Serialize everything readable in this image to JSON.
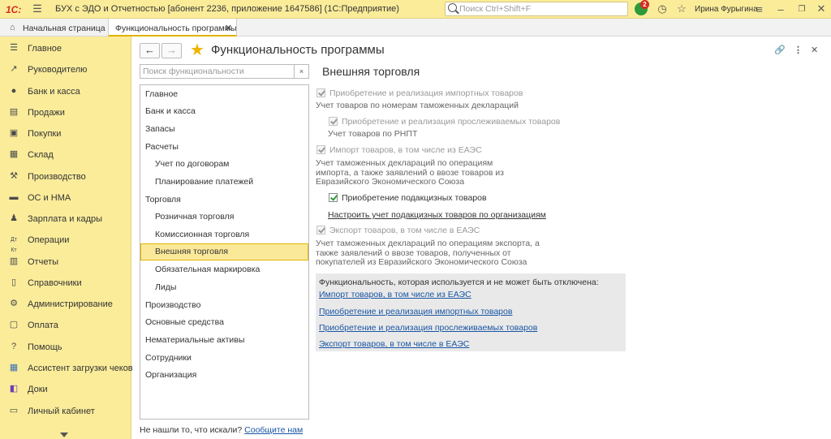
{
  "topbar": {
    "logo": "1С:",
    "title": "БУХ с ЭДО и Отчетностью [абонент 2236, приложение 1647586]  (1С:Предприятие)",
    "search_placeholder": "Поиск Ctrl+Shift+F",
    "notifications_count": "2",
    "user": "Ирина Фурыгина"
  },
  "tabs": {
    "home": "Начальная страница",
    "active": "Функциональность программы"
  },
  "sidebar": {
    "items": [
      {
        "label": "Главное",
        "icon": "menu-icon"
      },
      {
        "label": "Руководителю",
        "icon": "trend-icon"
      },
      {
        "label": "Банк и касса",
        "icon": "coin-icon"
      },
      {
        "label": "Продажи",
        "icon": "cart-icon"
      },
      {
        "label": "Покупки",
        "icon": "basket-icon"
      },
      {
        "label": "Склад",
        "icon": "warehouse-icon"
      },
      {
        "label": "Производство",
        "icon": "factory-icon"
      },
      {
        "label": "ОС и НМА",
        "icon": "truck-icon"
      },
      {
        "label": "Зарплата и кадры",
        "icon": "person-icon"
      },
      {
        "label": "Операции",
        "icon": "operations-icon"
      },
      {
        "label": "Отчеты",
        "icon": "bar-chart-icon"
      },
      {
        "label": "Справочники",
        "icon": "book-icon"
      },
      {
        "label": "Администрирование",
        "icon": "gear-icon"
      },
      {
        "label": "Оплата",
        "icon": "wallet-icon"
      },
      {
        "label": "Помощь",
        "icon": "question-icon"
      },
      {
        "label": "Ассистент загрузки чеков",
        "icon": "grid-icon"
      },
      {
        "label": "Доки",
        "icon": "docs-icon"
      },
      {
        "label": "Личный кабинет",
        "icon": "cabinet-icon"
      }
    ]
  },
  "form": {
    "title": "Функциональность программы",
    "search_placeholder": "Поиск функциональности",
    "clear": "×",
    "tree": [
      {
        "label": "Главное",
        "level": 0
      },
      {
        "label": "Банк и касса",
        "level": 0
      },
      {
        "label": "Запасы",
        "level": 0
      },
      {
        "label": "Расчеты",
        "level": 0
      },
      {
        "label": "Учет по договорам",
        "level": 1
      },
      {
        "label": "Планирование платежей",
        "level": 1
      },
      {
        "label": "Торговля",
        "level": 0
      },
      {
        "label": "Розничная торговля",
        "level": 1
      },
      {
        "label": "Комиссионная торговля",
        "level": 1
      },
      {
        "label": "Внешняя торговля",
        "level": 1,
        "selected": true
      },
      {
        "label": "Обязательная маркировка",
        "level": 1
      },
      {
        "label": "Лиды",
        "level": 1
      },
      {
        "label": "Производство",
        "level": 0
      },
      {
        "label": "Основные средства",
        "level": 0
      },
      {
        "label": "Нематериальные активы",
        "level": 0
      },
      {
        "label": "Сотрудники",
        "level": 0
      },
      {
        "label": "Организация",
        "level": 0
      }
    ],
    "not_found": "Не нашли то, что искали?",
    "contact_link": "Сообщите нам"
  },
  "section": {
    "title": "Внешняя торговля",
    "opt1_label": "Приобретение и реализация импортных товаров",
    "opt1_desc": "Учет товаров по номерам таможенных деклараций",
    "opt2_label": "Приобретение и реализация прослеживаемых товаров",
    "opt2_desc": "Учет товаров по РНПТ",
    "opt3_label": "Импорт товаров, в том числе из ЕАЭС",
    "opt3_desc": "Учет таможенных деклараций по операциям импорта, а также заявлений о ввозе товаров из Евразийского Экономического Союза",
    "opt4_label": "Приобретение подакцизных товаров",
    "opt4_link": "Настроить учет подакцизных товаров по организациям",
    "opt5_label": "Экспорт товаров, в том числе в ЕАЭС",
    "opt5_desc": "Учет таможенных деклараций по операциям экспорта, а также заявлений о ввозе товаров, полученных от покупателей из Евразийского Экономического Союза",
    "info_caption": "Функциональность, которая используется и не может быть отключена:",
    "info_links": [
      "Импорт товаров, в том числе из ЕАЭС",
      "Приобретение и реализация импортных товаров",
      "Приобретение и реализация прослеживаемых товаров",
      "Экспорт товаров, в том числе в ЕАЭС"
    ]
  }
}
